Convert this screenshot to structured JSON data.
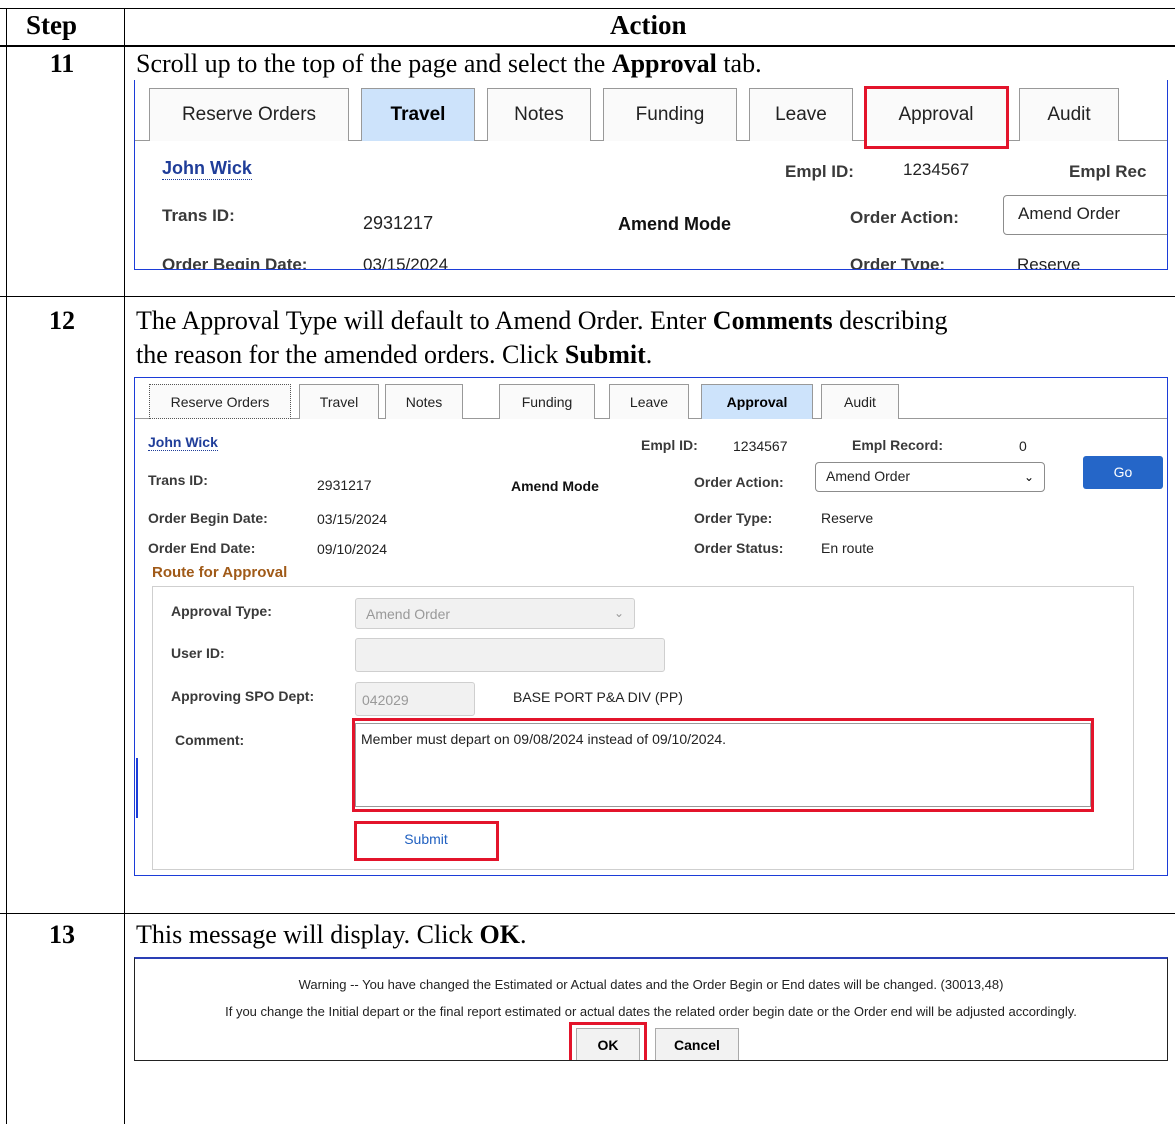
{
  "table": {
    "header_step": "Step",
    "header_action": "Action"
  },
  "steps": [
    {
      "number": "11",
      "text_before": "Scroll up to the top of the page and select the ",
      "text_bold": "Approval",
      "text_after": " tab."
    },
    {
      "number": "12",
      "line1_before": "The Approval Type will default to Amend Order. Enter ",
      "line1_bold": "Comments",
      "line1_after": " describing",
      "line2_before": "the reason for the amended orders. Click ",
      "line2_bold": "Submit",
      "line2_after": "."
    },
    {
      "number": "13",
      "text_before": "This message will display. Click ",
      "text_bold": "OK",
      "text_after": "."
    }
  ],
  "shot1": {
    "tabs": [
      "Reserve Orders",
      "Travel",
      "Notes",
      "Funding",
      "Leave",
      "Approval",
      "Audit"
    ],
    "active_tab": "Travel",
    "name": "John Wick",
    "empl_id_label": "Empl ID:",
    "empl_id_value": "1234567",
    "empl_record_label": "Empl Rec",
    "trans_id_label": "Trans ID:",
    "trans_id_value": "2931217",
    "mode": "Amend Mode",
    "order_action_label": "Order Action:",
    "order_action_value": "Amend Order",
    "order_begin_label": "Order Begin Date:",
    "order_begin_value": "03/15/2024",
    "order_type_label": "Order Type:",
    "order_type_value": "Reserve"
  },
  "shot2": {
    "tabs": [
      "Reserve Orders",
      "Travel",
      "Notes",
      "Funding",
      "Leave",
      "Approval",
      "Audit"
    ],
    "active_tab": "Approval",
    "name": "John Wick",
    "empl_id_label": "Empl ID:",
    "empl_id_value": "1234567",
    "empl_record_label": "Empl Record:",
    "empl_record_value": "0",
    "trans_id_label": "Trans ID:",
    "trans_id_value": "2931217",
    "mode": "Amend Mode",
    "order_action_label": "Order Action:",
    "order_action_value": "Amend Order",
    "go_label": "Go",
    "order_begin_label": "Order Begin Date:",
    "order_begin_value": "03/15/2024",
    "order_type_label": "Order Type:",
    "order_type_value": "Reserve",
    "order_end_label": "Order End Date:",
    "order_end_value": "09/10/2024",
    "order_status_label": "Order Status:",
    "order_status_value": "En route",
    "section_title": "Route for Approval",
    "approval_type_label": "Approval Type:",
    "approval_type_value": "Amend Order",
    "user_id_label": "User ID:",
    "user_id_value": "",
    "approving_dept_label": "Approving SPO Dept:",
    "approving_dept_value": "042029",
    "approving_dept_desc": "BASE PORT P&A DIV (PP)",
    "comment_label": "Comment:",
    "comment_value": "Member must depart on 09/08/2024 instead of 09/10/2024.",
    "submit_label": "Submit"
  },
  "shot3": {
    "line1": "Warning -- You have changed the Estimated or Actual dates and the Order Begin or End dates will be changed. (30013,48)",
    "line2": "If you change the Initial depart or the final report estimated or actual dates the related order begin date or the Order end will be adjusted accordingly.",
    "ok_label": "OK",
    "cancel_label": "Cancel"
  },
  "colors": {
    "highlight_red": "#e3142b",
    "active_tab_blue": "#cde3fb",
    "link_blue": "#1f3d99",
    "go_button_blue": "#2566c8",
    "section_brown": "#a05a18"
  }
}
